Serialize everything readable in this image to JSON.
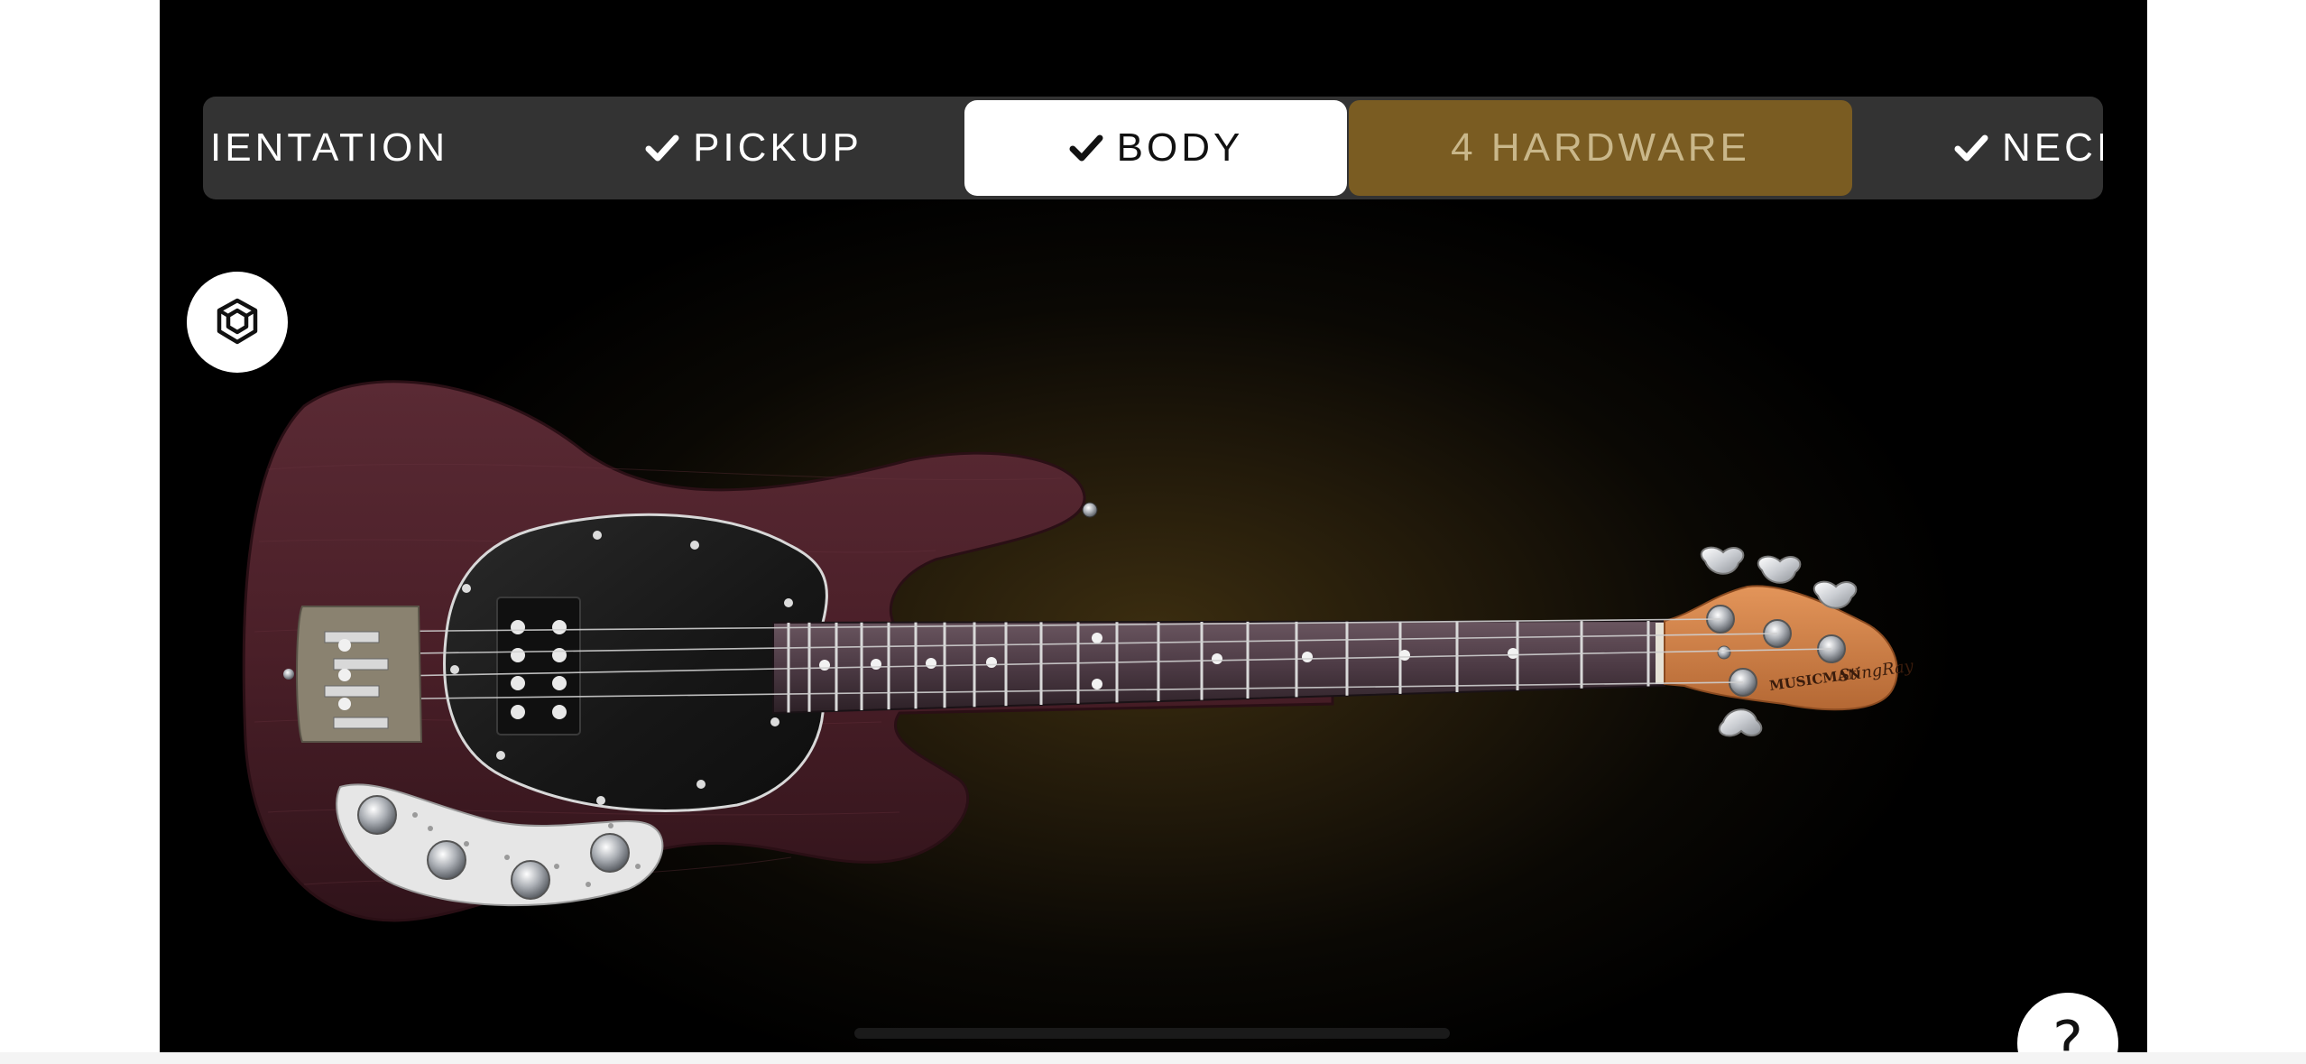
{
  "steps": {
    "orientation": {
      "label": "IENTATION"
    },
    "pickup": {
      "label": "PICKUP",
      "done": true
    },
    "body": {
      "label": "BODY",
      "done": true,
      "selected": true
    },
    "hardware": {
      "label": "4 HARDWARE",
      "active": true
    },
    "neck": {
      "label": "NECI",
      "done": true
    }
  },
  "headstock_logo": {
    "brand": "MUSICMAN",
    "model": "StingRay"
  },
  "help": {
    "label": "?"
  },
  "icons": {
    "view_toggle": "3d-view-icon",
    "check": "checkmark-icon",
    "help": "question-mark-icon"
  },
  "colors": {
    "step_bar_bg": "#333333",
    "step_selected_bg": "#ffffff",
    "step_active_bg": "#7a5c22",
    "step_active_text": "#c9b78a",
    "body_finish": "#4a1f28",
    "neck_wood": "#c87a42"
  }
}
